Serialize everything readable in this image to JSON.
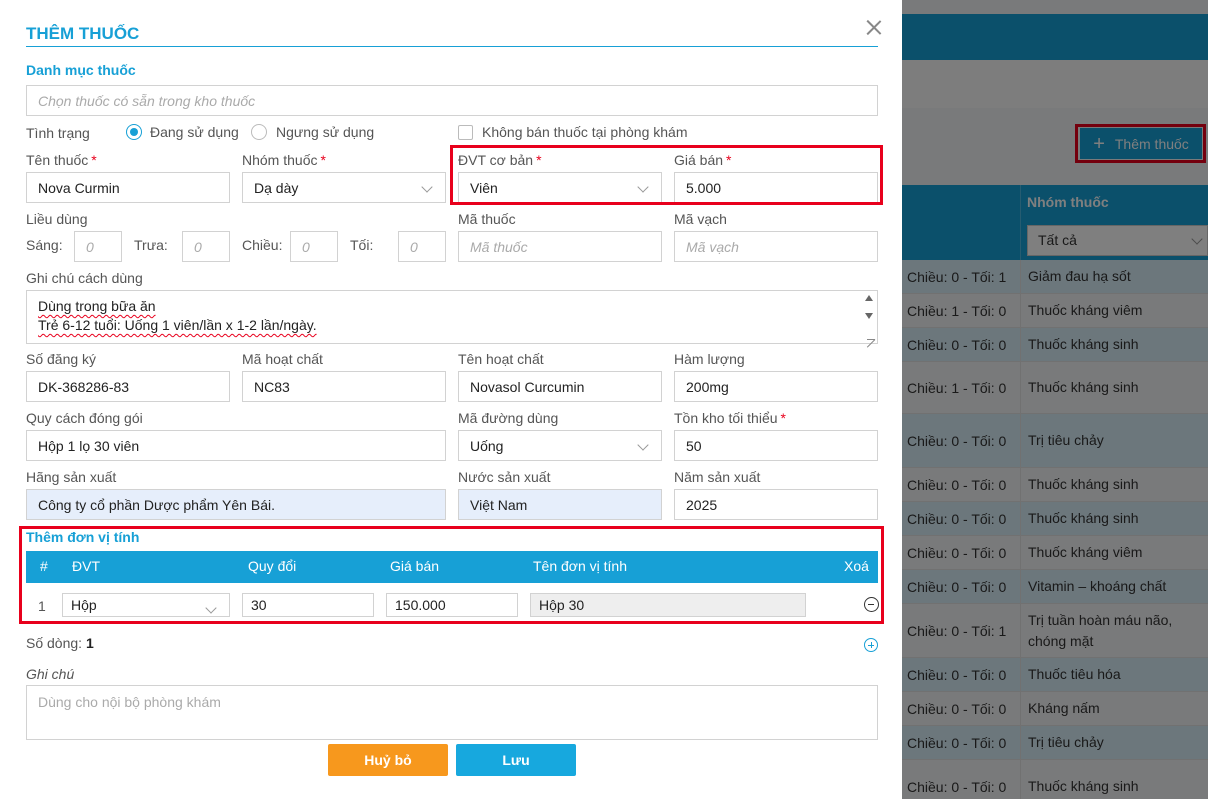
{
  "background": {
    "add_button_label": "Thêm thuốc",
    "table_header": "Nhóm thuốc",
    "filter_value": "Tất cả",
    "rows": [
      {
        "dose": "Chiều: 0 - Tối: 1",
        "group": "Giảm đau hạ sốt"
      },
      {
        "dose": "Chiều: 1 - Tối: 0",
        "group": "Thuốc kháng viêm"
      },
      {
        "dose": "Chiều: 0 - Tối: 0",
        "group": "Thuốc kháng sinh"
      },
      {
        "dose": "Chiều: 1 - Tối: 0",
        "group": "Thuốc kháng sinh"
      },
      {
        "dose": "Chiều: 0 - Tối: 0",
        "group": "Trị tiêu chảy"
      },
      {
        "dose": "Chiều: 0 - Tối: 0",
        "group": "Thuốc kháng sinh"
      },
      {
        "dose": "Chiều: 0 - Tối: 0",
        "group": "Thuốc kháng sinh"
      },
      {
        "dose": "Chiều: 0 - Tối: 0",
        "group": "Thuốc kháng viêm"
      },
      {
        "dose": "Chiều: 0 - Tối: 0",
        "group": "Vitamin – khoáng chất"
      },
      {
        "dose": "Chiều: 0 - Tối: 1",
        "group": "Trị tuần hoàn máu não, chóng mặt"
      },
      {
        "dose": "Chiều: 0 - Tối: 0",
        "group": "Thuốc tiêu hóa"
      },
      {
        "dose": "Chiều: 0 - Tối: 0",
        "group": "Kháng nấm"
      },
      {
        "dose": "Chiều: 0 - Tối: 0",
        "group": "Trị tiêu chảy"
      },
      {
        "dose": "Chiều: 0 - Tối: 0",
        "group": "Thuốc kháng sinh"
      }
    ]
  },
  "modal": {
    "title": "THÊM THUỐC",
    "catalog_section": "Danh mục thuốc",
    "catalog_placeholder": "Chọn thuốc có sẵn trong kho thuốc",
    "status_label": "Tình trạng",
    "status_active": "Đang sử dụng",
    "status_inactive": "Ngưng sử dụng",
    "not_sold_label": "Không bán thuốc tại phòng khám",
    "drug_name_label": "Tên thuốc",
    "drug_name_value": "Nova Curmin",
    "drug_group_label": "Nhóm thuốc",
    "drug_group_value": "Dạ dày",
    "base_unit_label": "ĐVT cơ bản",
    "base_unit_value": "Viên",
    "price_label": "Giá bán",
    "price_value": "5.000",
    "dosage_label": "Liều dùng",
    "morning_label": "Sáng:",
    "noon_label": "Trưa:",
    "afternoon_label": "Chiều:",
    "evening_label": "Tối:",
    "dose_placeholder": "0",
    "drug_code_label": "Mã thuốc",
    "drug_code_placeholder": "Mã thuốc",
    "barcode_label": "Mã vạch",
    "barcode_placeholder": "Mã vạch",
    "usage_note_label": "Ghi chú cách dùng",
    "usage_note_line1": "Dùng trong bữa ăn",
    "usage_note_line2": "Trẻ 6-12 tuổi: Uống 1 viên/lần x 1-2 lần/ngày.",
    "reg_no_label": "Số đăng ký",
    "reg_no_value": "DK-368286-83",
    "ingredient_code_label": "Mã hoạt chất",
    "ingredient_code_value": "NC83",
    "ingredient_name_label": "Tên hoạt chất",
    "ingredient_name_value": "Novasol Curcumin",
    "strength_label": "Hàm lượng",
    "strength_value": "200mg",
    "packaging_label": "Quy cách đóng gói",
    "packaging_value": "Hộp 1 lọ 30 viên",
    "route_label": "Mã đường dùng",
    "route_value": "Uống",
    "min_stock_label": "Tồn kho tối thiểu",
    "min_stock_value": "50",
    "manufacturer_label": "Hãng sản xuất",
    "manufacturer_value": "Công ty cổ phần Dược phẩm Yên Bái.",
    "country_label": "Nước sản xuất",
    "country_value": "Việt Nam",
    "year_label": "Năm sản xuất",
    "year_value": "2025",
    "units_section": "Thêm đơn vị tính",
    "units_header": {
      "no": "#",
      "unit": "ĐVT",
      "conversion": "Quy đổi",
      "price": "Giá bán",
      "unit_name": "Tên đơn vị tính",
      "delete": "Xoá"
    },
    "units_rows": [
      {
        "no": "1",
        "unit": "Hộp",
        "conversion": "30",
        "price": "150.000",
        "unit_name": "Hộp 30"
      }
    ],
    "row_count_label": "Số dòng:",
    "row_count_value": "1",
    "notes_label": "Ghi chú",
    "notes_placeholder": "Dùng cho nội bộ phòng khám",
    "cancel_label": "Huỷ bỏ",
    "save_label": "Lưu"
  }
}
